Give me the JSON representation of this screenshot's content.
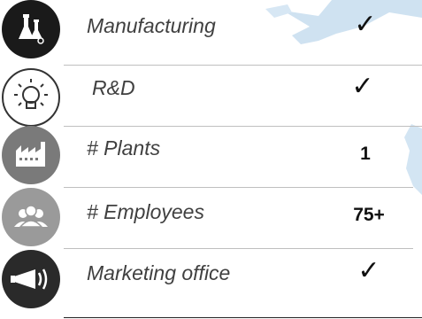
{
  "rows": [
    {
      "label": "Manufacturing",
      "value": "✓",
      "icon": "lab-flask-icon",
      "icon_bg": "#1a1a1a"
    },
    {
      "label": "R&D",
      "value": "✓",
      "icon": "lightbulb-icon",
      "icon_bg": "#ffffff"
    },
    {
      "label": "# Plants",
      "value": "1",
      "icon": "factory-icon",
      "icon_bg": "#7a7a7a"
    },
    {
      "label": "# Employees",
      "value": "75+",
      "icon": "people-icon",
      "icon_bg": "#9a9a9a"
    },
    {
      "label": "Marketing office",
      "value": "✓",
      "icon": "megaphone-icon",
      "icon_bg": "#2a2a2a"
    }
  ],
  "colors": {
    "divider": "#bfbfbf",
    "text": "#404040",
    "map": "#cde0ef"
  }
}
